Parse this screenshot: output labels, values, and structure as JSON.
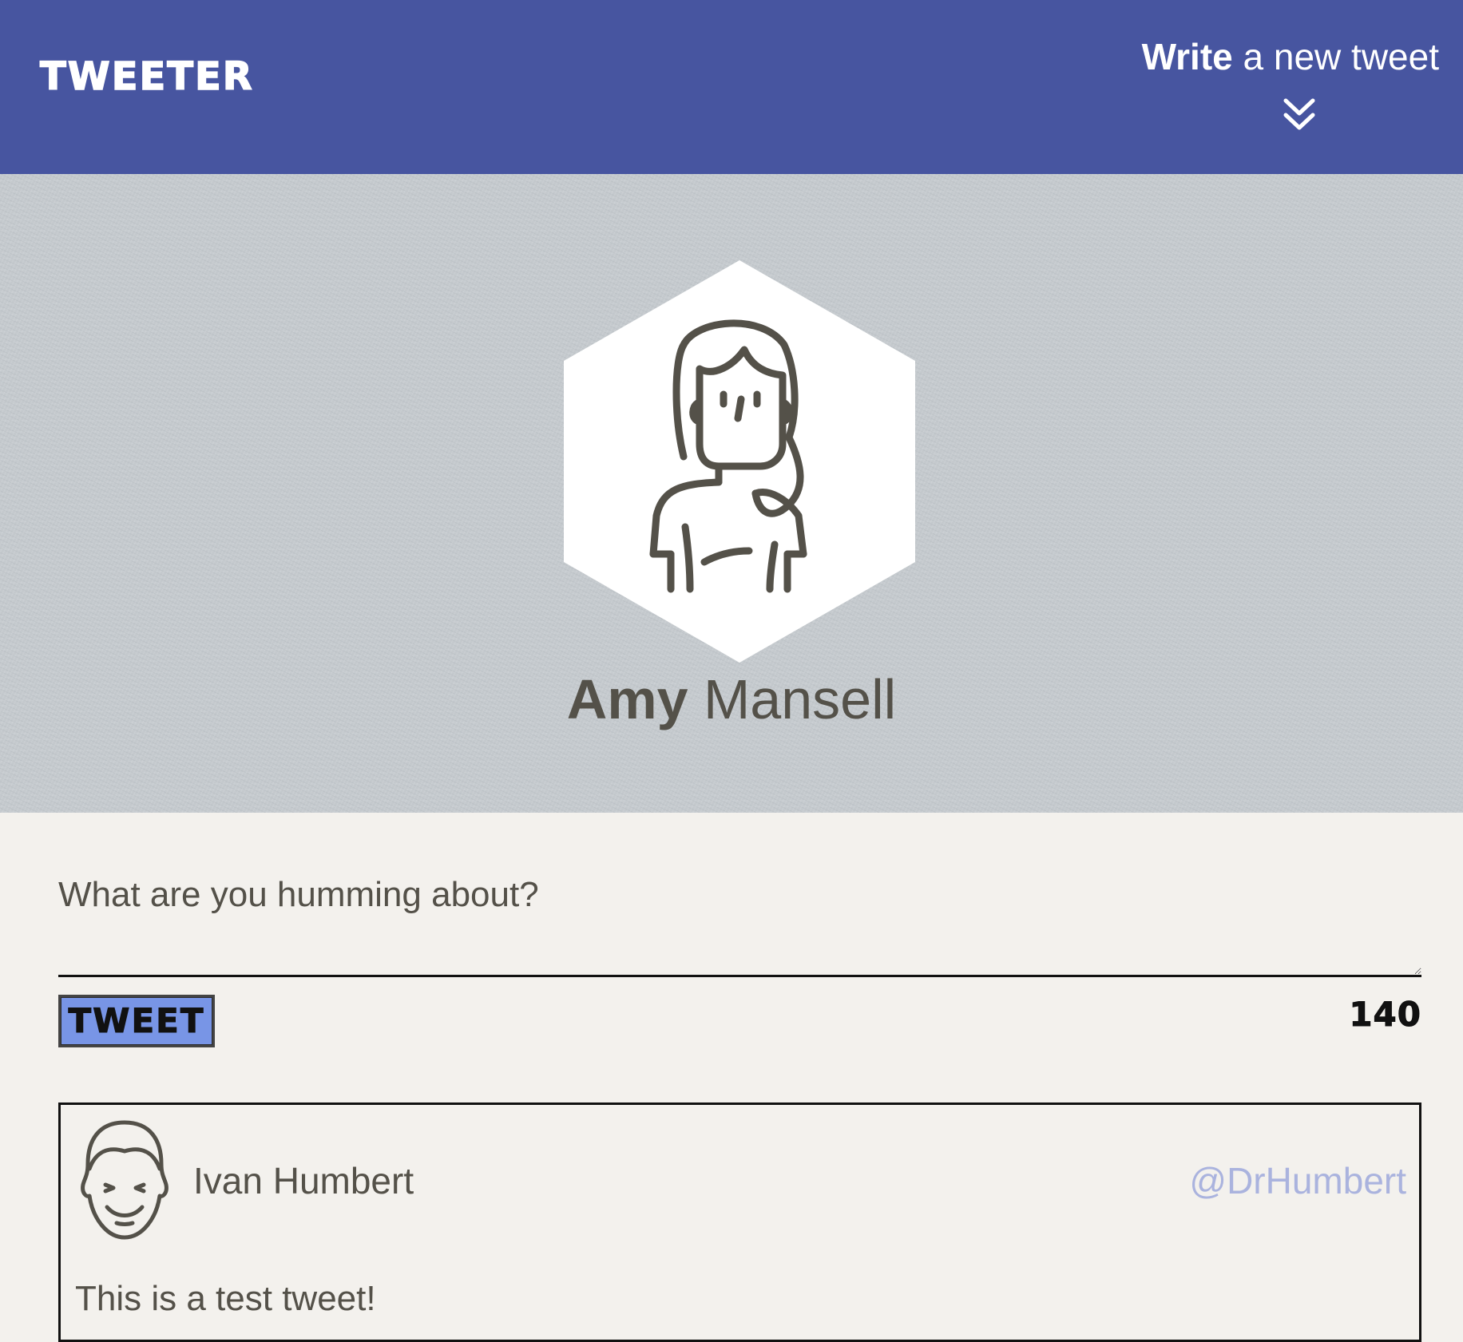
{
  "nav": {
    "brand": "TWEETER",
    "compose_strong": "Write",
    "compose_rest": "a new tweet",
    "toggle_icon": "double-chevron-down-icon"
  },
  "profile": {
    "first_name": "Amy",
    "last_name": "Mansell",
    "avatar_icon": "woman-avatar-icon"
  },
  "compose": {
    "placeholder": "What are you humming about?",
    "value": "",
    "button_label": "TWEET",
    "char_count": "140"
  },
  "tweets": [
    {
      "author": "Ivan Humbert",
      "handle": "@DrHumbert",
      "text": "This is a test tweet!",
      "avatar_icon": "man-avatar-icon"
    }
  ],
  "colors": {
    "nav_bg": "#4755a0",
    "page_bg": "#f3f1ed",
    "profile_bg": "#c4c9cd",
    "button_bg": "#7895e6",
    "handle_color": "#aab3de",
    "text_color": "#545149"
  }
}
